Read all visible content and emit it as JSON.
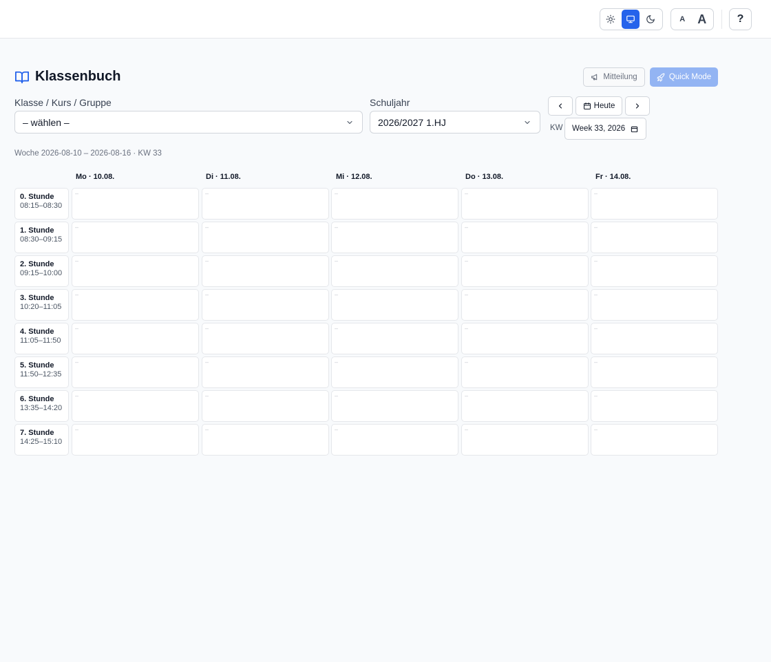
{
  "topbar": {
    "theme_icons": [
      "sun-icon",
      "monitor-icon",
      "moon-icon"
    ],
    "active_theme": "monitor",
    "font_small": "A",
    "font_large": "A",
    "help": "?"
  },
  "header": {
    "title": "Klassenbuch",
    "mitteilung_label": "Mitteilung",
    "quick_mode_label": "Quick Mode"
  },
  "filters": {
    "klasse_label": "Klasse / Kurs / Gruppe",
    "klasse_value": "– wählen –",
    "schuljahr_label": "Schuljahr",
    "schuljahr_value": "2026/2027 1.HJ",
    "heute_label": "Heute",
    "kw_label": "KW",
    "week_value": "Week 33, 2026"
  },
  "week_summary": "Woche 2026-08-10 – 2026-08-16 · KW 33",
  "days": [
    "Mo · 10.08.",
    "Di · 11.08.",
    "Mi · 12.08.",
    "Do · 13.08.",
    "Fr · 14.08."
  ],
  "periods": [
    {
      "name": "0. Stunde",
      "time": "08:15–08:30"
    },
    {
      "name": "1. Stunde",
      "time": "08:30–09:15"
    },
    {
      "name": "2. Stunde",
      "time": "09:15–10:00"
    },
    {
      "name": "3. Stunde",
      "time": "10:20–11:05"
    },
    {
      "name": "4. Stunde",
      "time": "11:05–11:50"
    },
    {
      "name": "5. Stunde",
      "time": "11:50–12:35"
    },
    {
      "name": "6. Stunde",
      "time": "13:35–14:20"
    },
    {
      "name": "7. Stunde",
      "time": "14:25–15:10"
    }
  ],
  "empty_cell": "–",
  "colors": {
    "accent": "#2563eb",
    "quick_mode": "#93b4f3",
    "background": "#f8fafc",
    "border": "#e5e7eb"
  }
}
